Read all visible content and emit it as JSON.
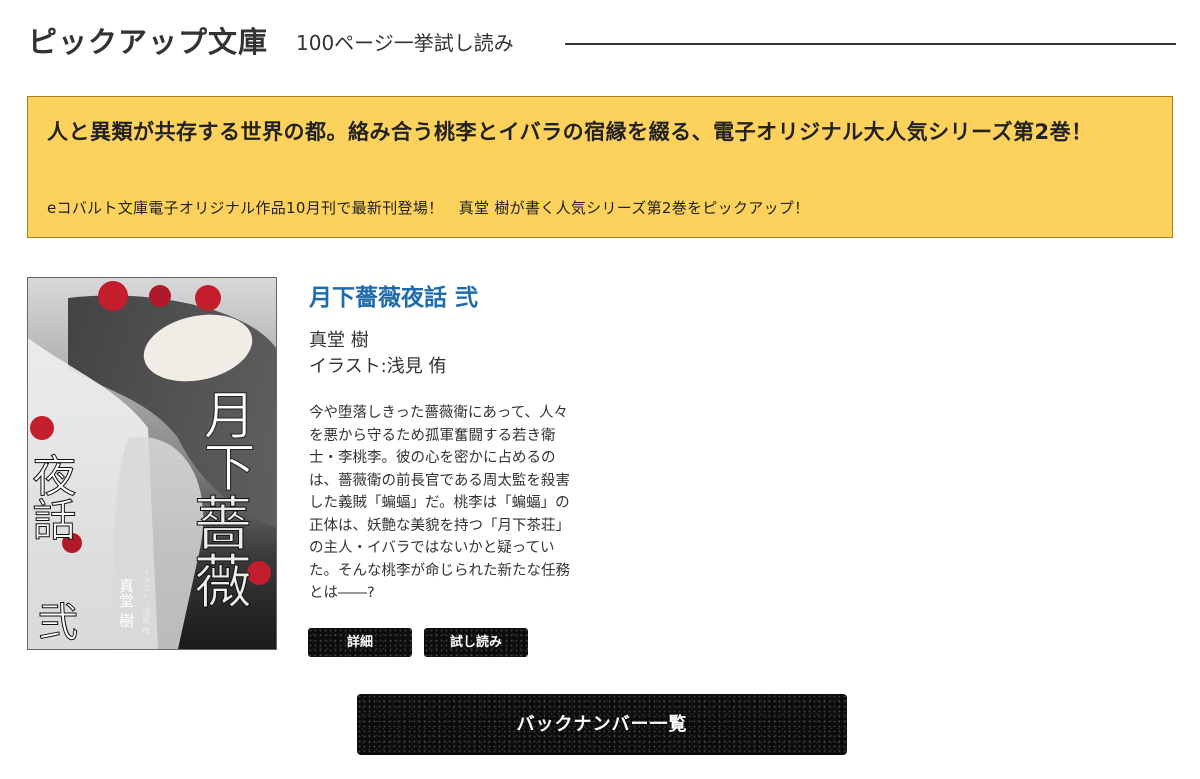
{
  "header": {
    "title": "ピックアップ文庫",
    "subtitle": "100ページ一挙試し読み"
  },
  "banner": {
    "headline": "人と異類が共存する世界の都。絡み合う桃李とイバラの宿縁を綴る、電子オリジナル大人気シリーズ第2巻！",
    "subline": "eコバルト文庫電子オリジナル作品10月刊で最新刊登場！　真堂 樹が書く人気シリーズ第2巻をピックアップ！"
  },
  "book": {
    "title": "月下薔薇夜話 弐",
    "author": "真堂 樹",
    "illustrator": "イラスト:浅見 侑",
    "description": "今や堕落しきった薔薇衛にあって、人々\nを悪から守るため孤軍奮闘する若き衛\n士・李桃李。彼の心を密かに占めるの\nは、薔薇衛の前長官である周太監を殺害\nした義賊「蝙蝠」だ。桃李は「蝙蝠」の\n正体は、妖艶な美貌を持つ「月下茶荘」\nの主人・イバラではないかと疑ってい\nた。そんな桃李が命じられた新たな任務\nとは――?",
    "cover": {
      "title_top": "月下",
      "title_rose": "薔薇",
      "title_left": "夜話",
      "volume": "弐",
      "author": "真堂 樹",
      "illustrator": "イラスト：浅見 侑"
    }
  },
  "buttons": {
    "detail": "詳細",
    "trial": "試し読み",
    "backnumber": "バックナンバー一覧"
  },
  "colors": {
    "banner_bg": "#fdd25c",
    "title_blue": "#1f6aa8",
    "button_dark": "#0c0c0c"
  }
}
